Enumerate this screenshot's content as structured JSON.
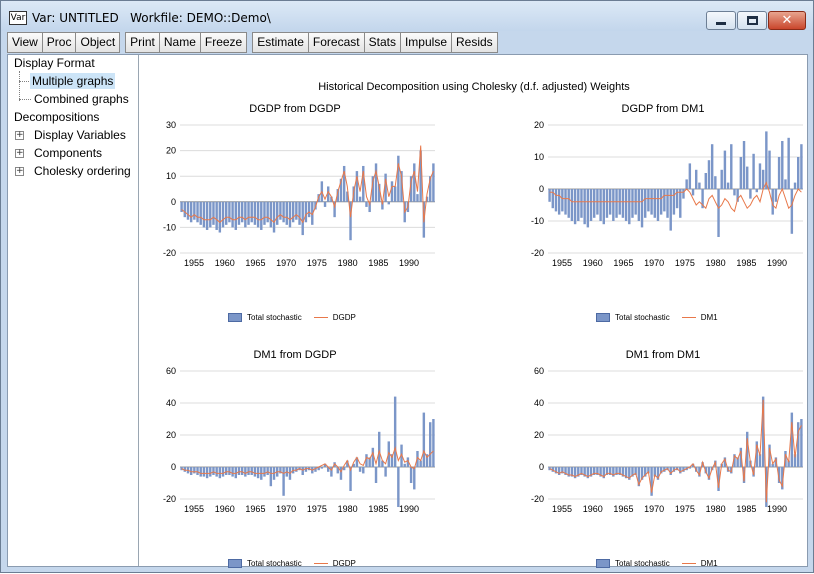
{
  "window": {
    "icon_text": "Var",
    "title": "Var: UNTITLED   Workfile: DEMO::Demo\\"
  },
  "toolbar": {
    "group1": [
      "View",
      "Proc",
      "Object"
    ],
    "group2": [
      "Print",
      "Name",
      "Freeze"
    ],
    "group3": [
      "Estimate",
      "Forecast",
      "Stats",
      "Impulse",
      "Resids"
    ]
  },
  "tree": {
    "display_format": "Display Format",
    "multiple_graphs": "Multiple graphs",
    "combined_graphs": "Combined graphs",
    "decompositions": "Decompositions",
    "display_variables": "Display Variables",
    "components": "Components",
    "cholesky_ordering": "Cholesky ordering"
  },
  "figure": {
    "title": "Historical Decomposition using Cholesky (d.f. adjusted) Weights"
  },
  "chart_data": [
    {
      "type": "bar",
      "title": "DGDP from DGDP",
      "xticks": [
        "1955",
        "1960",
        "1965",
        "1970",
        "1975",
        "1980",
        "1985",
        "1990"
      ],
      "ylim": [
        -20,
        30
      ],
      "yticks": [
        -20,
        -10,
        0,
        10,
        20,
        30
      ],
      "legend": [
        "Total stochastic",
        "DGDP"
      ],
      "legend_position": "bottom",
      "series": [
        {
          "name": "Total stochastic",
          "values": [
            -4,
            -6,
            -7,
            -8,
            -7,
            -8,
            -9,
            -10,
            -11,
            -10,
            -9,
            -11,
            -12,
            -10,
            -9,
            -8,
            -10,
            -11,
            -9,
            -8,
            -10,
            -9,
            -8,
            -9,
            -10,
            -11,
            -9,
            -8,
            -10,
            -12,
            -9,
            -7,
            -8,
            -9,
            -10,
            -8,
            -7,
            -9,
            -13,
            -8,
            -6,
            -9,
            -3,
            3,
            8,
            -2,
            6,
            2,
            -6,
            5,
            9,
            14,
            4,
            -15,
            6,
            12,
            2,
            14,
            -2,
            -4,
            10,
            15,
            7,
            -3,
            11,
            -1,
            8,
            6,
            18,
            12,
            -8,
            -4,
            10,
            15,
            3,
            20,
            -14,
            2,
            10,
            15
          ]
        },
        {
          "name": "DGDP",
          "values": [
            -3,
            -4,
            -5,
            -6,
            -5,
            -6,
            -6,
            -7,
            -7,
            -7,
            -6,
            -7,
            -8,
            -7,
            -6,
            -6,
            -7,
            -7,
            -6,
            -6,
            -7,
            -6,
            -6,
            -6,
            -7,
            -7,
            -6,
            -6,
            -7,
            -8,
            -6,
            -5,
            -6,
            -6,
            -7,
            -6,
            -5,
            -6,
            -8,
            -5,
            -4,
            -5,
            -2,
            2,
            4,
            1,
            4,
            2,
            -2,
            4,
            8,
            12,
            6,
            -6,
            4,
            10,
            4,
            12,
            2,
            -1,
            8,
            12,
            6,
            -1,
            9,
            2,
            6,
            6,
            15,
            10,
            -4,
            -2,
            8,
            12,
            4,
            22,
            -8,
            3,
            9,
            12
          ]
        }
      ]
    },
    {
      "type": "bar",
      "title": "DGDP from DM1",
      "xticks": [
        "1955",
        "1960",
        "1965",
        "1970",
        "1975",
        "1980",
        "1985",
        "1990"
      ],
      "ylim": [
        -20,
        20
      ],
      "yticks": [
        -20,
        -10,
        0,
        10,
        20
      ],
      "legend": [
        "Total stochastic",
        "DM1"
      ],
      "legend_position": "bottom",
      "series": [
        {
          "name": "Total stochastic",
          "values": [
            -4,
            -6,
            -7,
            -8,
            -7,
            -8,
            -9,
            -10,
            -11,
            -10,
            -9,
            -11,
            -12,
            -10,
            -9,
            -8,
            -10,
            -11,
            -9,
            -8,
            -10,
            -9,
            -8,
            -9,
            -10,
            -11,
            -9,
            -8,
            -10,
            -12,
            -9,
            -7,
            -8,
            -9,
            -10,
            -8,
            -7,
            -9,
            -13,
            -8,
            -6,
            -9,
            -3,
            3,
            8,
            -2,
            6,
            2,
            -6,
            5,
            9,
            14,
            4,
            -15,
            6,
            12,
            2,
            14,
            -2,
            -4,
            10,
            15,
            7,
            -3,
            11,
            -1,
            8,
            6,
            18,
            12,
            -8,
            -4,
            10,
            15,
            3,
            16,
            -14,
            2,
            10,
            14
          ]
        },
        {
          "name": "DM1",
          "values": [
            -1,
            -1,
            -2,
            -2,
            -3,
            -3,
            -3,
            -4,
            -4,
            -4,
            -4,
            -4,
            -4,
            -4,
            -4,
            -4,
            -4,
            -4,
            -4,
            -4,
            -4,
            -4,
            -4,
            -4,
            -4,
            -4,
            -4,
            -4,
            -4,
            -4,
            -3,
            -3,
            -3,
            -3,
            -3,
            -3,
            -2,
            -2,
            -2,
            -2,
            -1,
            -1,
            -1,
            0,
            -1,
            -3,
            -5,
            -4,
            -5,
            -6,
            -3,
            -2,
            -4,
            -6,
            -5,
            -3,
            -4,
            -6,
            -7,
            -3,
            -2,
            -4,
            -6,
            -5,
            -3,
            -2,
            -4,
            0,
            2,
            -1,
            -5,
            -6,
            -2,
            0,
            -3,
            -6,
            -5,
            -2,
            0,
            -1
          ]
        }
      ]
    },
    {
      "type": "bar",
      "title": "DM1 from DGDP",
      "xticks": [
        "1955",
        "1960",
        "1965",
        "1970",
        "1975",
        "1980",
        "1985",
        "1990"
      ],
      "ylim": [
        -20,
        60
      ],
      "yticks": [
        -20,
        0,
        20,
        40,
        60
      ],
      "legend": [
        "Total stochastic",
        "DGDP"
      ],
      "legend_position": "bottom",
      "series": [
        {
          "name": "Total stochastic",
          "values": [
            -2,
            -3,
            -4,
            -5,
            -4,
            -5,
            -6,
            -6,
            -7,
            -6,
            -5,
            -6,
            -7,
            -6,
            -5,
            -5,
            -6,
            -7,
            -5,
            -5,
            -6,
            -5,
            -5,
            -6,
            -7,
            -8,
            -6,
            -5,
            -12,
            -8,
            -6,
            -4,
            -18,
            -6,
            -8,
            -4,
            -3,
            -2,
            -5,
            -3,
            -2,
            -4,
            -3,
            -2,
            -1,
            2,
            -3,
            -6,
            3,
            -4,
            -8,
            -2,
            4,
            -15,
            2,
            6,
            -3,
            -4,
            8,
            6,
            12,
            -10,
            22,
            4,
            -6,
            16,
            8,
            44,
            -25,
            14,
            2,
            6,
            -10,
            -14,
            10,
            4,
            34,
            8,
            28,
            30
          ]
        },
        {
          "name": "DGDP",
          "values": [
            -1,
            -2,
            -2,
            -3,
            -3,
            -3,
            -4,
            -4,
            -4,
            -4,
            -3,
            -4,
            -4,
            -4,
            -3,
            -3,
            -4,
            -4,
            -3,
            -3,
            -4,
            -3,
            -3,
            -4,
            -4,
            -4,
            -4,
            -3,
            -4,
            -4,
            -3,
            -3,
            -4,
            -3,
            -4,
            -2,
            -2,
            -1,
            -2,
            -1,
            -1,
            -2,
            -1,
            0,
            1,
            2,
            0,
            -2,
            2,
            0,
            -3,
            1,
            4,
            -2,
            3,
            6,
            2,
            1,
            6,
            5,
            9,
            2,
            10,
            4,
            2,
            9,
            6,
            12,
            4,
            8,
            3,
            4,
            0,
            -1,
            6,
            4,
            10,
            6,
            8,
            10
          ]
        }
      ]
    },
    {
      "type": "bar",
      "title": "DM1 from DM1",
      "xticks": [
        "1955",
        "1960",
        "1965",
        "1970",
        "1975",
        "1980",
        "1985",
        "1990"
      ],
      "ylim": [
        -20,
        60
      ],
      "yticks": [
        -20,
        0,
        20,
        40,
        60
      ],
      "legend": [
        "Total stochastic",
        "DM1"
      ],
      "legend_position": "bottom",
      "series": [
        {
          "name": "Total stochastic",
          "values": [
            -2,
            -3,
            -4,
            -5,
            -4,
            -5,
            -6,
            -6,
            -7,
            -6,
            -5,
            -6,
            -7,
            -6,
            -5,
            -5,
            -6,
            -7,
            -5,
            -5,
            -6,
            -5,
            -5,
            -6,
            -7,
            -8,
            -6,
            -5,
            -12,
            -8,
            -6,
            -4,
            -18,
            -6,
            -8,
            -4,
            -3,
            -2,
            -5,
            -3,
            -2,
            -4,
            -3,
            -2,
            -1,
            2,
            -3,
            -6,
            3,
            -4,
            -8,
            -2,
            4,
            -15,
            2,
            6,
            -3,
            -4,
            8,
            6,
            12,
            -10,
            22,
            4,
            -6,
            16,
            8,
            44,
            -25,
            14,
            2,
            6,
            -10,
            -14,
            10,
            4,
            34,
            8,
            28,
            30
          ]
        },
        {
          "name": "DM1",
          "values": [
            -1,
            -2,
            -3,
            -4,
            -3,
            -4,
            -5,
            -5,
            -6,
            -5,
            -4,
            -5,
            -6,
            -5,
            -4,
            -4,
            -5,
            -6,
            -4,
            -4,
            -5,
            -4,
            -4,
            -5,
            -6,
            -7,
            -5,
            -4,
            -11,
            -7,
            -5,
            -3,
            -16,
            -5,
            -7,
            -3,
            -2,
            -1,
            -4,
            -2,
            -1,
            -3,
            -2,
            -1,
            0,
            2,
            -2,
            -5,
            3,
            -3,
            -7,
            -1,
            3,
            -13,
            2,
            5,
            -2,
            -3,
            7,
            5,
            10,
            -9,
            18,
            3,
            -5,
            14,
            7,
            42,
            -22,
            12,
            2,
            5,
            -8,
            -12,
            8,
            3,
            28,
            6,
            22,
            26
          ]
        }
      ]
    }
  ]
}
